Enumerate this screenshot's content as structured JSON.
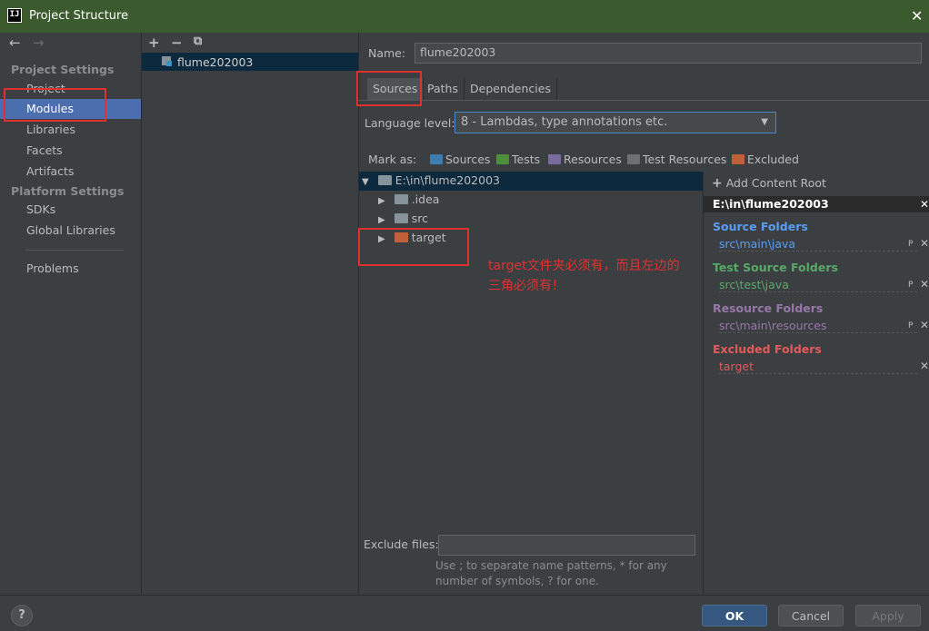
{
  "window": {
    "title": "Project Structure",
    "close": "✕"
  },
  "nav": {
    "back": "←",
    "forward": "→",
    "project_settings_header": "Project Settings",
    "project_settings": [
      "Project",
      "Modules",
      "Libraries",
      "Facets",
      "Artifacts"
    ],
    "platform_settings_header": "Platform Settings",
    "platform_settings": [
      "SDKs",
      "Global Libraries"
    ],
    "problems": "Problems",
    "selected": "Modules"
  },
  "module_toolbar": {
    "add": "+",
    "remove": "−",
    "copy": "⧉"
  },
  "modules": [
    "flume202003"
  ],
  "name_field": {
    "label": "Name:",
    "value": "flume202003"
  },
  "tabs": [
    "Sources",
    "Paths",
    "Dependencies"
  ],
  "language_level": {
    "label": "Language level:",
    "value": "8 - Lambdas, type annotations etc."
  },
  "mark_as": {
    "label": "Mark as:",
    "items": [
      "Sources",
      "Tests",
      "Resources",
      "Test Resources",
      "Excluded"
    ]
  },
  "tree": {
    "root": "E:\\in\\flume202003",
    "children": [
      ".idea",
      "src",
      "target"
    ]
  },
  "roots": {
    "add_content_root": "Add Content Root",
    "root_path": "E:\\in\\flume202003",
    "source_folders": {
      "header": "Source Folders",
      "path": "src\\main\\java"
    },
    "test_source_folders": {
      "header": "Test Source Folders",
      "path": "src\\test\\java"
    },
    "resource_folders": {
      "header": "Resource Folders",
      "path": "src\\main\\resources"
    },
    "excluded_folders": {
      "header": "Excluded Folders",
      "path": "target"
    }
  },
  "exclude_files": {
    "label": "Exclude files:",
    "value": "",
    "hint_line1": "Use ; to separate name patterns, * for any",
    "hint_line2": "number of symbols, ? for one."
  },
  "buttons": {
    "help": "?",
    "ok": "OK",
    "cancel": "Cancel",
    "apply": "Apply"
  },
  "annotation": {
    "line1": "target文件夹必须有，而且左边的",
    "line2": "三角必须有！"
  },
  "colors": {
    "sources": "#3d7db0",
    "tests": "#4e8f3a",
    "resources": "#7a6a9e",
    "test_resources": "#6f6f6f",
    "excluded": "#c0603a",
    "source_hdr": "#589df6",
    "test_hdr": "#59a869",
    "resource_hdr": "#9876aa",
    "excluded_hdr": "#e35a5a",
    "annotation": "#e03131"
  }
}
